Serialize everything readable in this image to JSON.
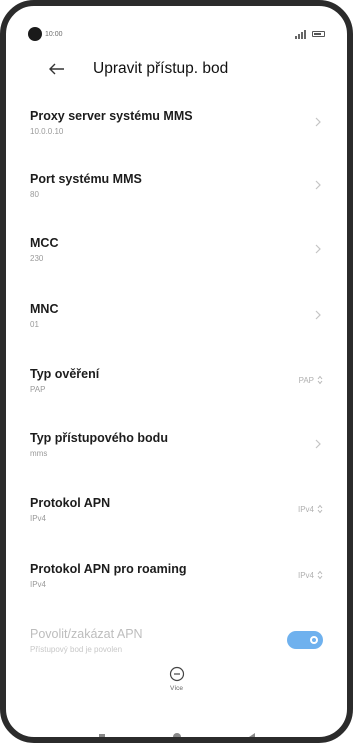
{
  "status_bar": {
    "time": "10:00",
    "signal": "4G signal",
    "battery": "battery-icon"
  },
  "header": {
    "title": "Upravit přístup. bod",
    "back_icon": "back-arrow-icon"
  },
  "settings": [
    {
      "title": "Proxy server systému MMS",
      "value": "10.0.0.10",
      "control": "chevron"
    },
    {
      "title": "Port systému MMS",
      "value": "80",
      "control": "chevron"
    },
    {
      "title": "MCC",
      "value": "230",
      "control": "chevron"
    },
    {
      "title": "MNC",
      "value": "01",
      "control": "chevron"
    },
    {
      "title": "Typ ověření",
      "value": "PAP",
      "control": "select",
      "selected": "PAP"
    },
    {
      "title": "Typ přístupového bodu",
      "value": "mms",
      "control": "chevron"
    },
    {
      "title": "Protokol APN",
      "value": "IPv4",
      "control": "select",
      "selected": "IPv4"
    },
    {
      "title": "Protokol APN pro roaming",
      "value": "IPv4",
      "control": "select",
      "selected": "IPv4"
    },
    {
      "title": "Povolit/zakázat APN",
      "value": "Přístupový bod je povolen",
      "control": "toggle",
      "enabled": true,
      "disabled": true
    }
  ],
  "more": {
    "label": "Více",
    "icon": "more-circle-icon"
  },
  "nav": {
    "recent": "square-icon",
    "home": "circle-icon",
    "back": "back-triangle-icon"
  },
  "colors": {
    "accent": "#6fb1ee",
    "title_text": "#1c1c1c",
    "subtext": "#9a9a9a"
  }
}
